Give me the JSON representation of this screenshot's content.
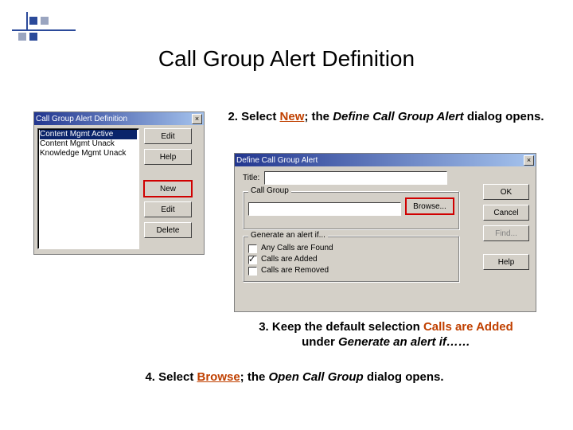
{
  "title": "Call Group Alert Definition",
  "step2": {
    "prefix": "2. Select ",
    "key": "New",
    "mid": "; the ",
    "em": "Define Call Group Alert",
    "suffix": " dialog opens."
  },
  "step3": {
    "prefix": "3. Keep the default selection ",
    "key": "Calls are Added",
    "mid": " under ",
    "em": "Generate an alert if……"
  },
  "step4": {
    "prefix": "4. Select ",
    "key": "Browse",
    "mid": "; the ",
    "em": "Open Call Group",
    "suffix": " dialog opens."
  },
  "dlg1": {
    "title": "Call Group Alert Definition",
    "items": [
      "Content Mgmt Active",
      "Content Mgmt Unack",
      "Knowledge Mgmt Unack"
    ],
    "buttons": {
      "edit": "Edit",
      "help": "Help",
      "new": "New",
      "edit2": "Edit",
      "delete": "Delete"
    }
  },
  "dlg2": {
    "title": "Define Call Group Alert",
    "titleLabel": "Title:",
    "callGroupLabel": "Call Group",
    "browse": "Browse...",
    "genLabel": "Generate an alert if...",
    "opts": {
      "any": "Any Calls are Found",
      "added": "Calls are Added",
      "removed": "Calls are Removed"
    },
    "buttons": {
      "ok": "OK",
      "cancel": "Cancel",
      "find": "Find...",
      "help": "Help"
    }
  }
}
